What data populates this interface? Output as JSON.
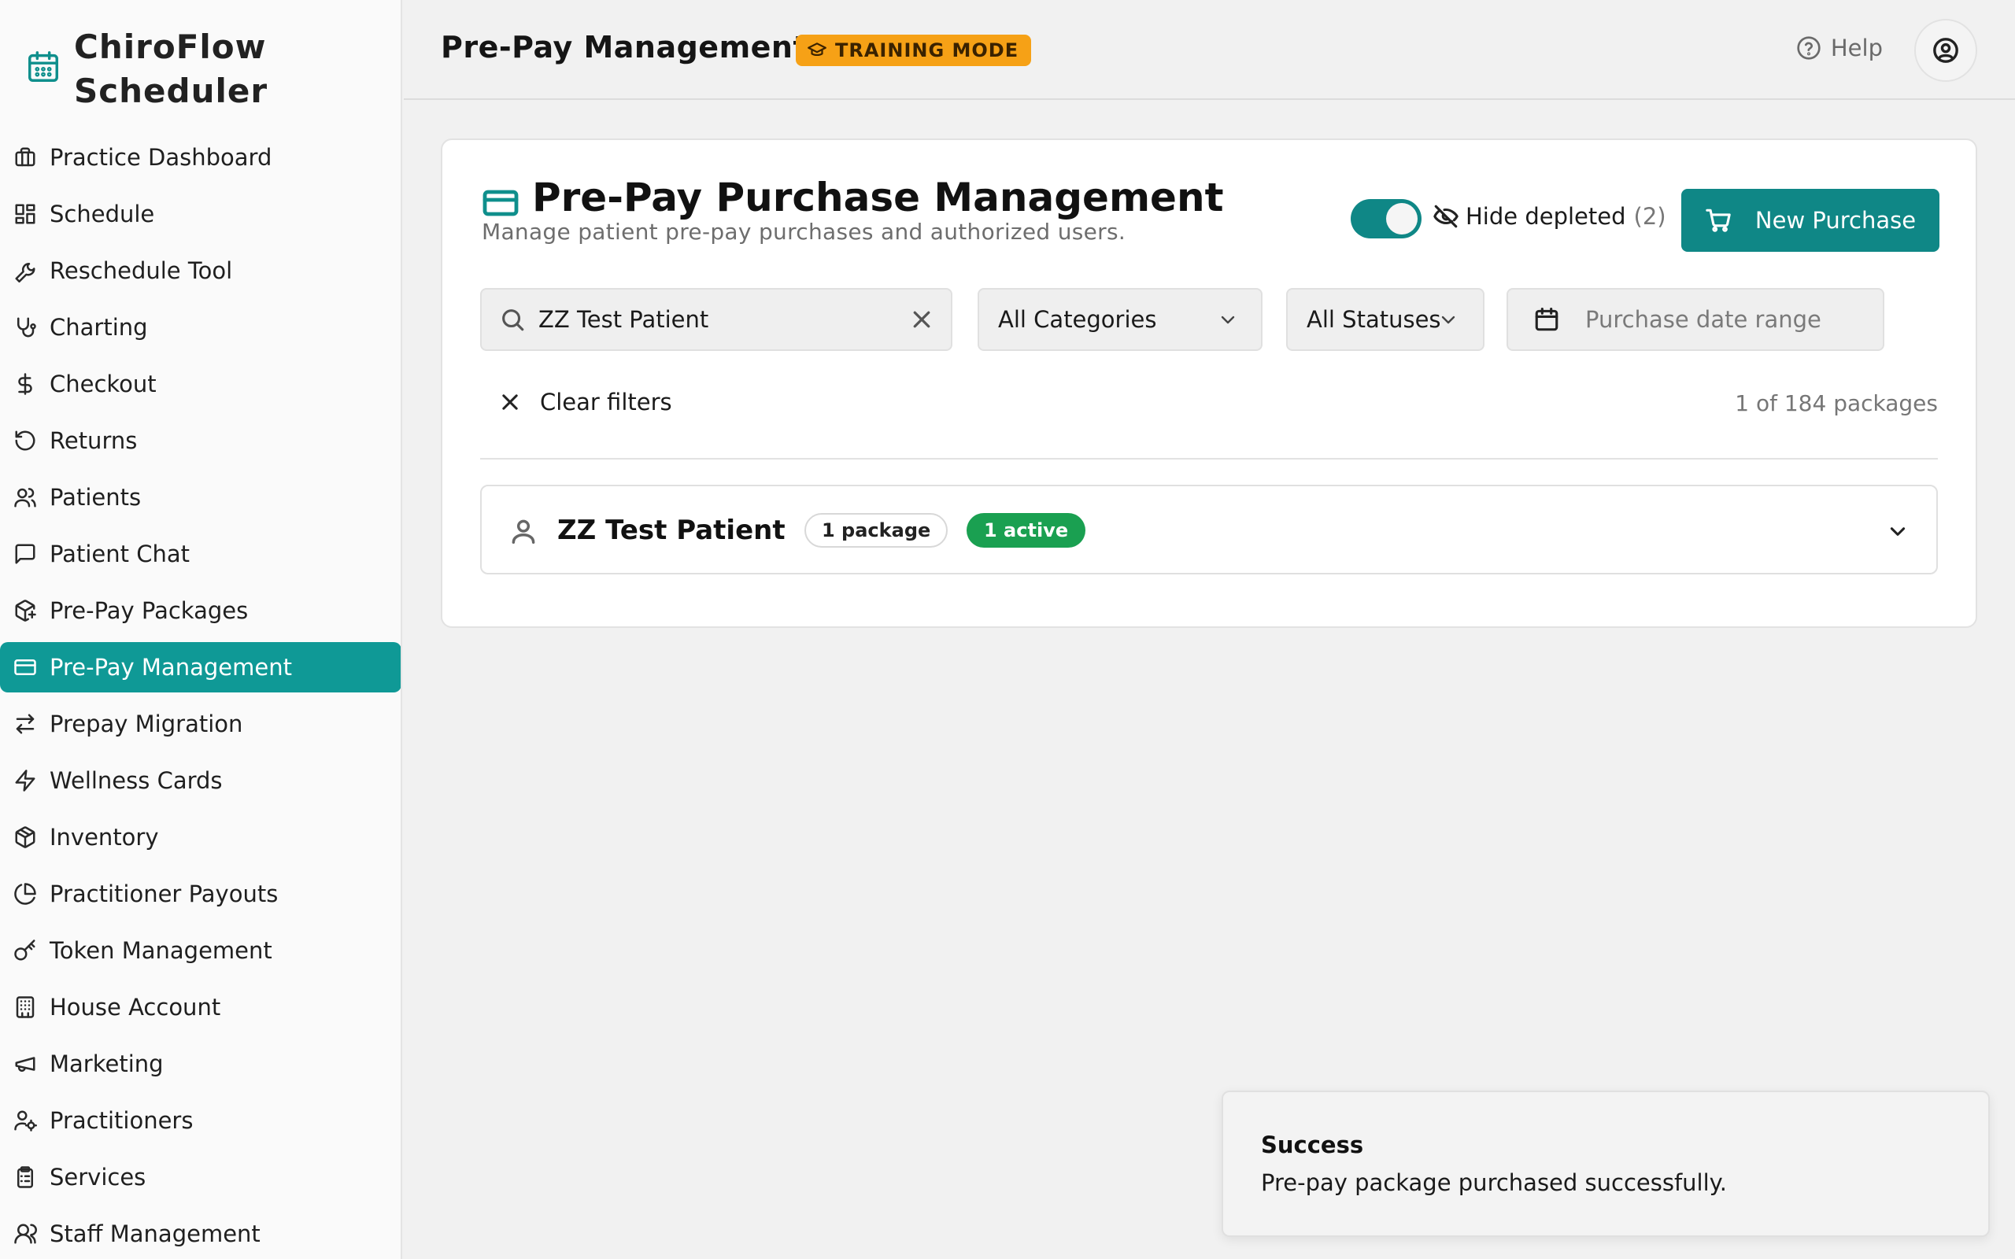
{
  "app": {
    "name_line1": "ChiroFlow",
    "name_line2": "Scheduler"
  },
  "sidebar": {
    "items": [
      {
        "label": "Practice Dashboard",
        "icon": "briefcase-icon"
      },
      {
        "label": "Schedule",
        "icon": "layout-grid-icon"
      },
      {
        "label": "Reschedule Tool",
        "icon": "wrench-icon"
      },
      {
        "label": "Charting",
        "icon": "stethoscope-icon"
      },
      {
        "label": "Checkout",
        "icon": "dollar-icon"
      },
      {
        "label": "Returns",
        "icon": "rotate-ccw-icon"
      },
      {
        "label": "Patients",
        "icon": "users-icon"
      },
      {
        "label": "Patient Chat",
        "icon": "message-square-icon"
      },
      {
        "label": "Pre-Pay Packages",
        "icon": "package-plus-icon"
      },
      {
        "label": "Pre-Pay Management",
        "icon": "credit-card-icon",
        "active": true
      },
      {
        "label": "Prepay Migration",
        "icon": "arrows-exchange-icon"
      },
      {
        "label": "Wellness Cards",
        "icon": "zap-icon"
      },
      {
        "label": "Inventory",
        "icon": "box-icon"
      },
      {
        "label": "Practitioner Payouts",
        "icon": "pie-chart-icon"
      },
      {
        "label": "Token Management",
        "icon": "key-icon"
      },
      {
        "label": "House Account",
        "icon": "building-icon"
      },
      {
        "label": "Marketing",
        "icon": "megaphone-icon"
      },
      {
        "label": "Practitioners",
        "icon": "user-cog-icon"
      },
      {
        "label": "Services",
        "icon": "clipboard-list-icon"
      },
      {
        "label": "Staff Management",
        "icon": "users-round-icon"
      }
    ]
  },
  "header": {
    "title": "Pre-Pay Management",
    "badge": "TRAINING MODE",
    "help": "Help"
  },
  "card": {
    "title": "Pre-Pay Purchase Management",
    "subtitle": "Manage patient pre-pay purchases and authorized users.",
    "hide_depleted_label": "Hide depleted",
    "hide_depleted_count": "(2)",
    "hide_depleted_on": true,
    "new_purchase": "New Purchase"
  },
  "filters": {
    "search_value": "ZZ Test Patient",
    "category": "All Categories",
    "status": "All Statuses",
    "date_placeholder": "Purchase date range",
    "clear": "Clear filters",
    "result_count": "1 of 184 packages"
  },
  "patients": [
    {
      "name": "ZZ Test Patient",
      "packages": "1 package",
      "active": "1 active"
    }
  ],
  "toast": {
    "title": "Success",
    "message": "Pre-pay package purchased successfully."
  },
  "colors": {
    "accent": "#0f8786",
    "active_nav": "#0f9996",
    "badge": "#f6a116",
    "active_pill": "#1aa051"
  }
}
